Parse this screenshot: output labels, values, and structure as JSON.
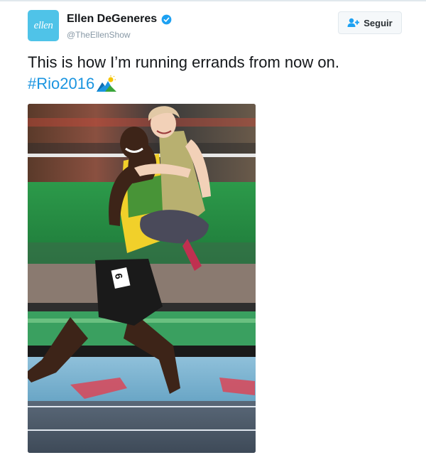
{
  "tweet": {
    "avatar_text": "ellen",
    "display_name": "Ellen DeGeneres",
    "handle": "@TheEllenShow",
    "follow_label": "Seguir",
    "text": "This is how I’m running errands from now on.",
    "hashtag": "#Rio2016",
    "hashflag_icon": "rio2016-mountain-icon",
    "verified_icon": "verified-badge-icon",
    "media": {
      "description_icon": "photo-sprinter-carrying-woman",
      "bib_number": "6"
    }
  },
  "colors": {
    "link": "#1b95e0",
    "verified": "#1da1f2",
    "text": "#14171a",
    "muted": "#8899a6"
  }
}
